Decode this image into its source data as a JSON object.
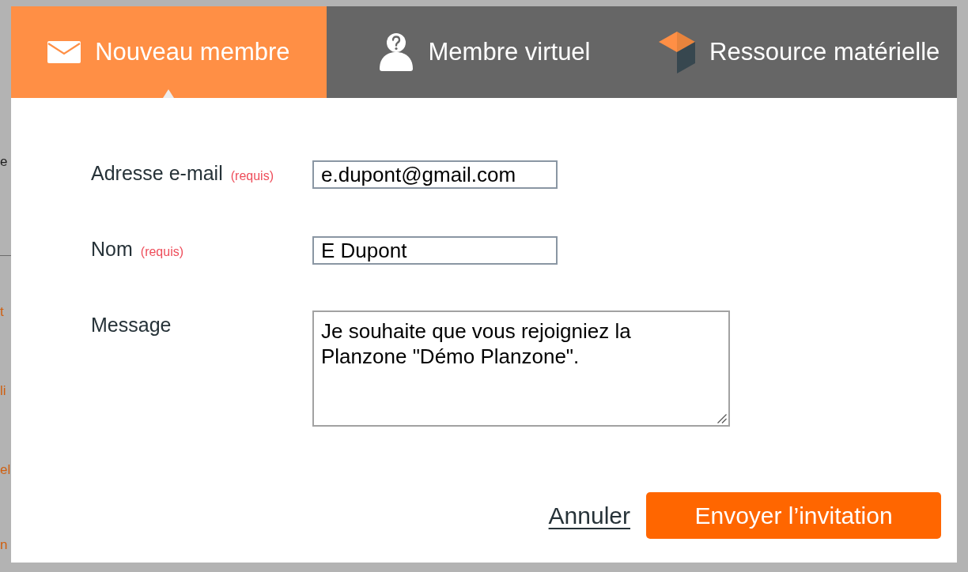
{
  "background": {
    "fragments": [
      {
        "text": "e",
        "kind": "heading"
      },
      {
        "text": "t",
        "kind": "link"
      },
      {
        "text": "li",
        "kind": "link"
      },
      {
        "text": "el",
        "kind": "link"
      },
      {
        "text": "n",
        "kind": "link"
      }
    ]
  },
  "tabs": [
    {
      "label": "Nouveau membre",
      "selected": true
    },
    {
      "label": "Membre virtuel",
      "selected": false
    },
    {
      "label": "Ressource matérielle",
      "selected": false
    }
  ],
  "form": {
    "fields": [
      {
        "kind": "input",
        "label": "Adresse e-mail",
        "required_note": "(requis)",
        "value": "e.dupont@gmail.com"
      },
      {
        "kind": "input",
        "label": "Nom",
        "required_note": "(requis)",
        "value": "E Dupont"
      },
      {
        "kind": "textarea",
        "label": "Message",
        "value": "Je souhaite que vous rejoigniez la Planzone \"Démo Planzone\"."
      }
    ]
  },
  "actions": {
    "cancel": "Annuler",
    "submit": "Envoyer l’invitation"
  }
}
